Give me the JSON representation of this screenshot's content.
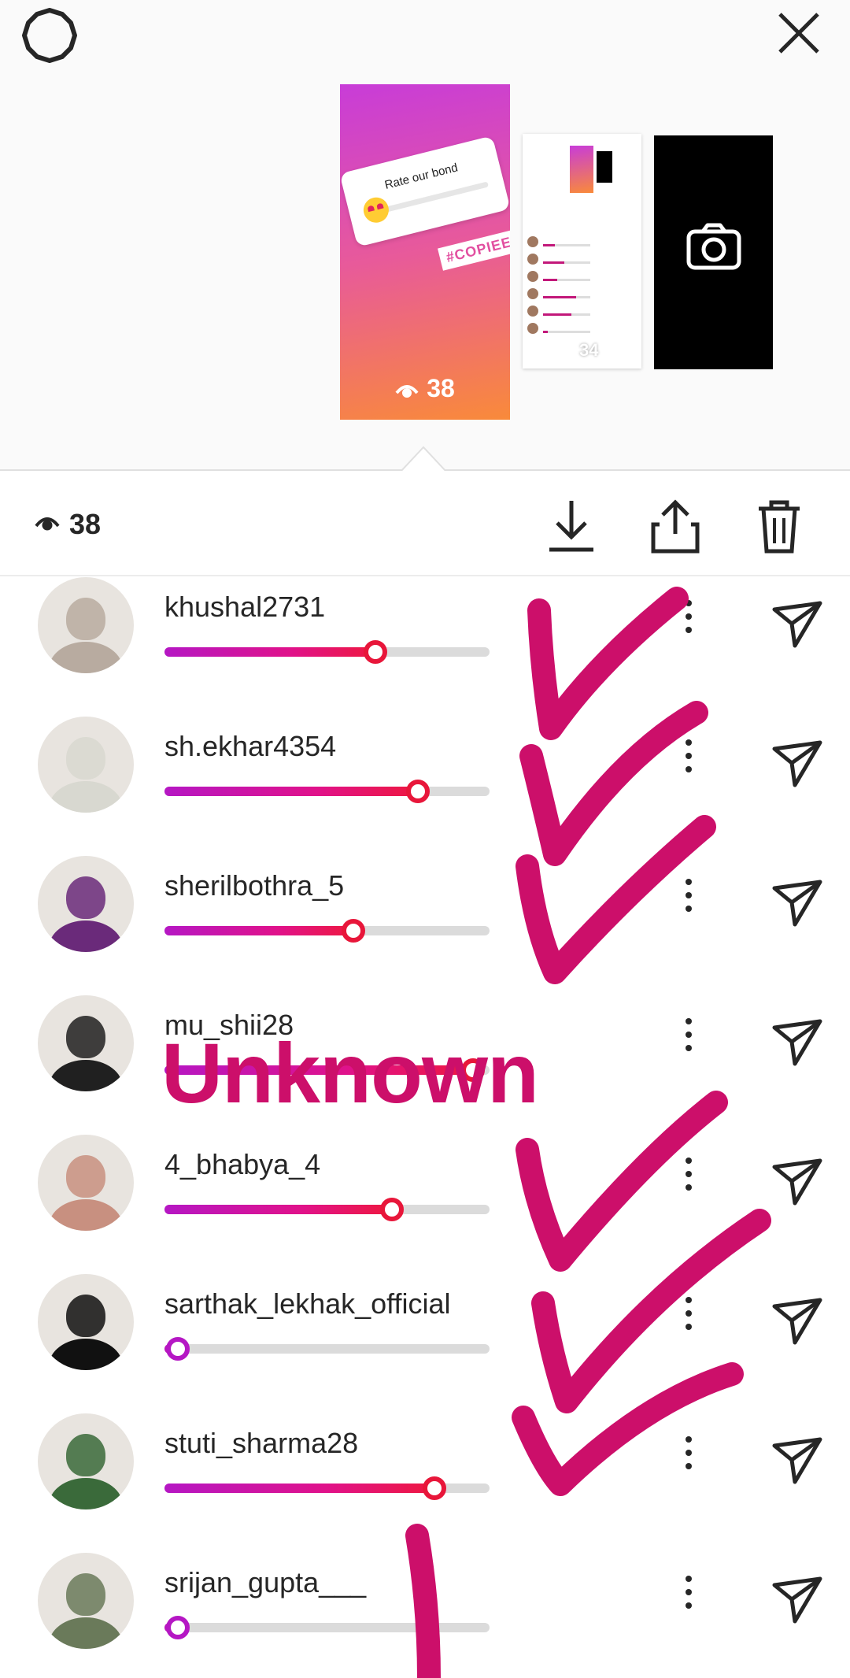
{
  "tray": {
    "settings_icon": "gear-icon",
    "close_icon": "close-icon",
    "current_story": {
      "poll_question": "Rate our bond",
      "hashtag": "#COPIEE",
      "view_count": "38"
    },
    "next_story_count": "34",
    "camera_icon": "camera-icon"
  },
  "toolbar": {
    "view_count": "38",
    "download_icon": "download-icon",
    "share_icon": "share-icon",
    "delete_icon": "trash-icon"
  },
  "viewers": [
    {
      "username": "khushal2731",
      "slider": 0.65,
      "avatar": "#b8aba0"
    },
    {
      "username": "sh.ekhar4354",
      "slider": 0.78,
      "avatar": "#d8d8d0"
    },
    {
      "username": "sherilbothra_5",
      "slider": 0.58,
      "avatar": "#6a2a7a"
    },
    {
      "username": "mu_shii28",
      "slider": 0.95,
      "avatar": "#202020"
    },
    {
      "username": "4_bhabya_4",
      "slider": 0.7,
      "avatar": "#c89080"
    },
    {
      "username": "sarthak_lekhak_official",
      "slider": 0.04,
      "avatar": "#111111"
    },
    {
      "username": "stuti_sharma28",
      "slider": 0.83,
      "avatar": "#3a6a3a"
    },
    {
      "username": "srijan_gupta___",
      "slider": 0.04,
      "avatar": "#6a7a5a"
    }
  ],
  "annotation": {
    "text": "Unknown",
    "color": "#cc0f6a"
  },
  "colors": {
    "slider_start": "#b517c4",
    "slider_end": "#ee1840",
    "ink": "#cc0f6a"
  }
}
